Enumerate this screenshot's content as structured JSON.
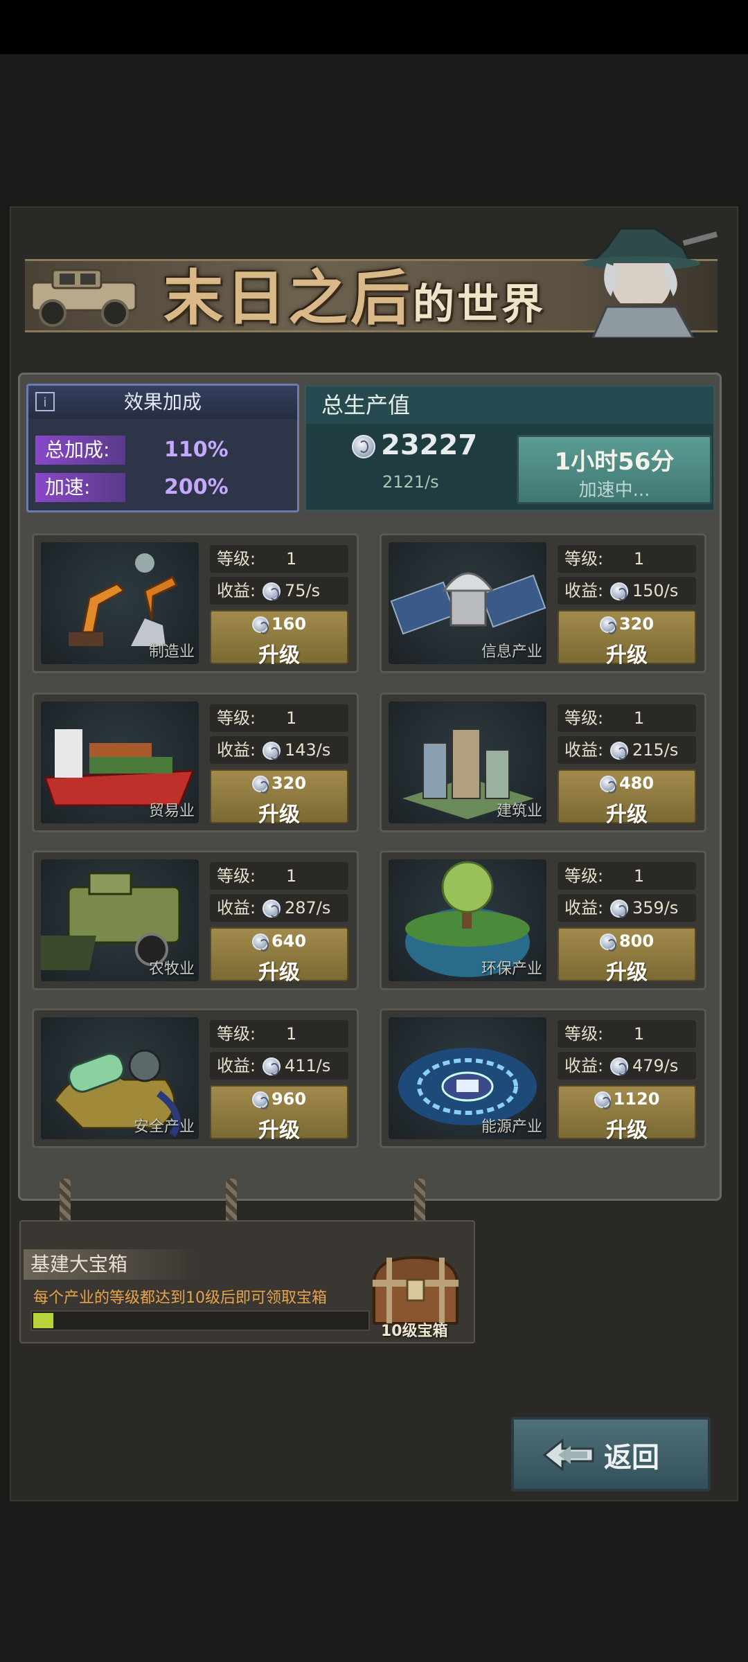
{
  "banner": {
    "title_main": "末日之后",
    "title_small": "的世界"
  },
  "bonus": {
    "header": "效果加成",
    "total_label": "总加成:",
    "total_value": "110%",
    "speed_label": "加速:",
    "speed_value": "200%"
  },
  "production": {
    "header": "总生产值",
    "value": "23227",
    "rate": "2121/s",
    "boost_time": "1小时56分",
    "boost_status": "加速中..."
  },
  "common": {
    "level_label": "等级:",
    "income_label": "收益:",
    "upgrade_label": "升级"
  },
  "industries": [
    {
      "name": "制造业",
      "level": "1",
      "income": "75/s",
      "cost": "160",
      "icon": "robot-arm-icon"
    },
    {
      "name": "信息产业",
      "level": "1",
      "income": "150/s",
      "cost": "320",
      "icon": "satellite-icon"
    },
    {
      "name": "贸易业",
      "level": "1",
      "income": "143/s",
      "cost": "320",
      "icon": "cargo-ship-icon"
    },
    {
      "name": "建筑业",
      "level": "1",
      "income": "215/s",
      "cost": "480",
      "icon": "city-buildings-icon"
    },
    {
      "name": "农牧业",
      "level": "1",
      "income": "287/s",
      "cost": "640",
      "icon": "harvester-icon"
    },
    {
      "name": "环保产业",
      "level": "1",
      "income": "359/s",
      "cost": "800",
      "icon": "tree-globe-icon"
    },
    {
      "name": "安全产业",
      "level": "1",
      "income": "411/s",
      "cost": "960",
      "icon": "gas-mask-icon"
    },
    {
      "name": "能源产业",
      "level": "1",
      "income": "479/s",
      "cost": "1120",
      "icon": "energy-portal-icon"
    }
  ],
  "treasure": {
    "title": "基建大宝箱",
    "description": "每个产业的等级都达到10级后即可领取宝箱",
    "progress": 0.06,
    "chest_label": "10级宝箱"
  },
  "back_button": {
    "label": "返回"
  },
  "colors": {
    "accent_gold": "#a28a4c",
    "bonus_purple": "#8a47c8",
    "teal": "#3f7771"
  }
}
